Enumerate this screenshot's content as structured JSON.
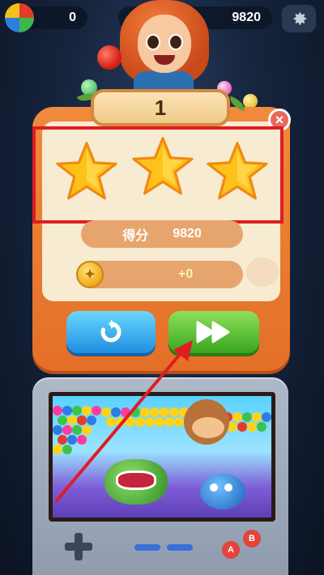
{
  "topbar": {
    "bubbles_count": "0",
    "score": "9820",
    "settings_icon": "gear-icon"
  },
  "level_panel": {
    "level_number": "1",
    "close_label": "×",
    "stars_earned": 3,
    "stars_total": 3,
    "score_label": "得分",
    "score_value": "9820",
    "coin_value": "+0"
  },
  "buttons": {
    "replay_icon": "replay-icon",
    "next_icon": "fast-forward-icon"
  },
  "handheld": {
    "a_label": "A",
    "b_label": "B"
  },
  "annotations": {
    "highlight_color": "#e01c24",
    "arrow_color": "#e01c24"
  },
  "colors": {
    "panel": "#e97a30",
    "paper": "#f7ebd2",
    "star": "#ffc21a",
    "blue_button": "#1f8fe0",
    "green_button": "#3aa51f"
  }
}
